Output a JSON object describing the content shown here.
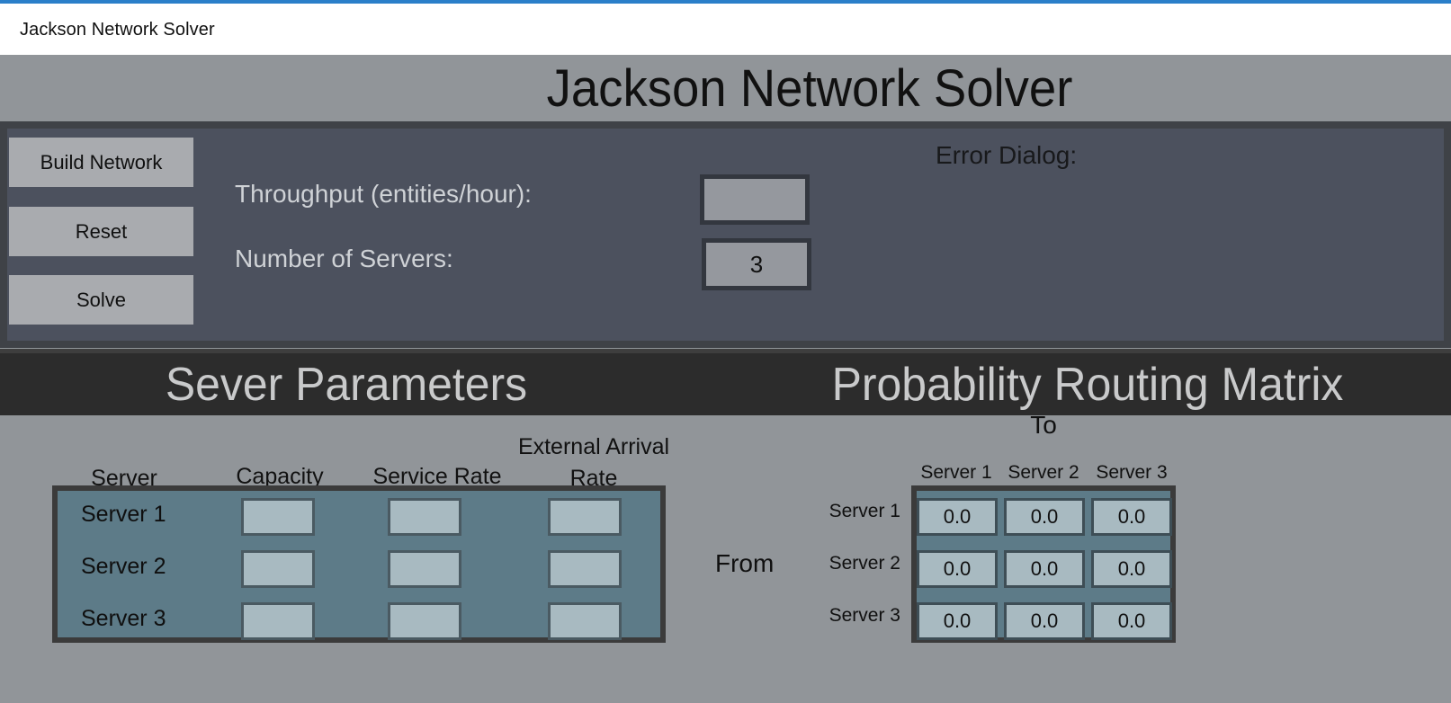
{
  "window": {
    "title": "Jackson Network Solver",
    "accent_color": "#2a7fc9"
  },
  "banner": {
    "title": "Jackson Network Solver"
  },
  "controls": {
    "buttons": [
      {
        "label": "Build Network",
        "name": "build-network-button"
      },
      {
        "label": "Reset",
        "name": "reset-button"
      },
      {
        "label": "Solve",
        "name": "solve-button"
      }
    ],
    "throughput": {
      "label": "Throughput (entities/hour):",
      "value": "",
      "placeholder": ""
    },
    "num_servers": {
      "label": "Number of Servers:",
      "value": "3",
      "placeholder": ""
    },
    "error_dialog": {
      "label": "Error Dialog:",
      "message": ""
    }
  },
  "sections": {
    "server_parameters_title": "Sever Parameters",
    "routing_matrix_title": "Probability Routing Matrix"
  },
  "server_table": {
    "headers": {
      "server": "Server",
      "capacity": "Capacity",
      "service_rate": "Service Rate",
      "external_arrival_rate": "External Arrival Rate"
    },
    "rows": [
      {
        "label": "Server 1",
        "capacity": "",
        "service_rate": "",
        "external_arrival_rate": ""
      },
      {
        "label": "Server 2",
        "capacity": "",
        "service_rate": "",
        "external_arrival_rate": ""
      },
      {
        "label": "Server 3",
        "capacity": "",
        "service_rate": "",
        "external_arrival_rate": ""
      }
    ]
  },
  "routing_matrix": {
    "to_label": "To",
    "from_label": "From",
    "col_headers": [
      "Server 1",
      "Server 2",
      "Server 3"
    ],
    "row_headers": [
      "Server 1",
      "Server 2",
      "Server 3"
    ],
    "values": [
      [
        "0.0",
        "0.0",
        "0.0"
      ],
      [
        "0.0",
        "0.0",
        "0.0"
      ],
      [
        "0.0",
        "0.0",
        "0.0"
      ]
    ]
  },
  "colors": {
    "page_bg": "#919599",
    "panel_bg": "#4c515e",
    "panel_border": "#3f4247",
    "band_bg": "#2c2c2c",
    "table_bg": "#5d7b88",
    "cell_bg": "#a8bac1",
    "button_bg": "#a9abaf"
  }
}
